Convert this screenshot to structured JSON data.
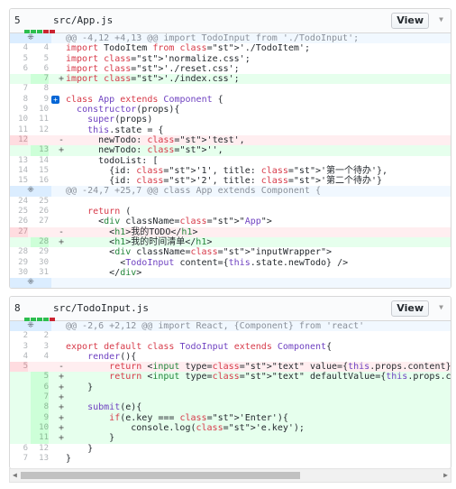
{
  "files": [
    {
      "count": "5",
      "path": "src/App.js",
      "view_label": "View",
      "bars": [
        "#2cbe4e",
        "#2cbe4e",
        "#2cbe4e",
        "#cb2431",
        "#cb2431"
      ],
      "rows": [
        {
          "t": "hunk",
          "o": "",
          "n": "",
          "s": "",
          "c": "@@ -4,12 +4,13 @@ import TodoInput from './TodoInput';"
        },
        {
          "t": "ctx",
          "o": "4",
          "n": "4",
          "s": "",
          "c": "import TodoItem from './TodoItem';"
        },
        {
          "t": "ctx",
          "o": "5",
          "n": "5",
          "s": "",
          "c": "import 'normalize.css';"
        },
        {
          "t": "ctx",
          "o": "6",
          "n": "6",
          "s": "",
          "c": "import './reset.css';"
        },
        {
          "t": "add",
          "o": "",
          "n": "7",
          "s": "+",
          "c": "import './index.css';"
        },
        {
          "t": "ctx",
          "o": "7",
          "n": "8",
          "s": "",
          "c": ""
        },
        {
          "t": "ctx",
          "o": "8",
          "n": "9",
          "s": "",
          "c": "class App extends Component {"
        },
        {
          "t": "ctx",
          "o": "9",
          "n": "10",
          "s": "",
          "c": "  constructor(props){"
        },
        {
          "t": "ctx",
          "o": "10",
          "n": "11",
          "s": "",
          "c": "    super(props)"
        },
        {
          "t": "ctx",
          "o": "11",
          "n": "12",
          "s": "",
          "c": "    this.state = {"
        },
        {
          "t": "del",
          "o": "12",
          "n": "",
          "s": "-",
          "c": "      newTodo: 'test',"
        },
        {
          "t": "add",
          "o": "",
          "n": "13",
          "s": "+",
          "c": "      newTodo: '',"
        },
        {
          "t": "ctx",
          "o": "13",
          "n": "14",
          "s": "",
          "c": "      todoList: ["
        },
        {
          "t": "ctx",
          "o": "14",
          "n": "15",
          "s": "",
          "c": "        {id: '1', title: '第一个待办'},"
        },
        {
          "t": "ctx",
          "o": "15",
          "n": "16",
          "s": "",
          "c": "        {id: '2', title: '第二个待办'}"
        },
        {
          "t": "hunk",
          "o": "",
          "n": "",
          "s": "",
          "c": "@@ -24,7 +25,7 @@ class App extends Component {"
        },
        {
          "t": "ctx",
          "o": "24",
          "n": "25",
          "s": "",
          "c": ""
        },
        {
          "t": "ctx",
          "o": "25",
          "n": "26",
          "s": "",
          "c": "    return ("
        },
        {
          "t": "ctx",
          "o": "26",
          "n": "27",
          "s": "",
          "c": "      <div className=\"App\">"
        },
        {
          "t": "del",
          "o": "27",
          "n": "",
          "s": "-",
          "c": "        <h1>我的TODO</h1>"
        },
        {
          "t": "add",
          "o": "",
          "n": "28",
          "s": "+",
          "c": "        <h1>我的时间清单</h1>"
        },
        {
          "t": "ctx",
          "o": "28",
          "n": "29",
          "s": "",
          "c": "        <div className=\"inputWrapper\">"
        },
        {
          "t": "ctx",
          "o": "29",
          "n": "30",
          "s": "",
          "c": "          <TodoInput content={this.state.newTodo} />"
        },
        {
          "t": "ctx",
          "o": "30",
          "n": "31",
          "s": "",
          "c": "        </div>"
        },
        {
          "t": "hunk",
          "o": "",
          "n": "",
          "s": "",
          "c": ""
        }
      ]
    },
    {
      "count": "8",
      "path": "src/TodoInput.js",
      "view_label": "View",
      "bars": [
        "#2cbe4e",
        "#2cbe4e",
        "#2cbe4e",
        "#2cbe4e",
        "#cb2431"
      ],
      "rows": [
        {
          "t": "hunk",
          "o": "",
          "n": "",
          "s": "",
          "c": "@@ -2,6 +2,12 @@ import React, {Component} from 'react'"
        },
        {
          "t": "ctx",
          "o": "2",
          "n": "2",
          "s": "",
          "c": ""
        },
        {
          "t": "ctx",
          "o": "3",
          "n": "3",
          "s": "",
          "c": "export default class TodoInput extends Component{"
        },
        {
          "t": "ctx",
          "o": "4",
          "n": "4",
          "s": "",
          "c": "    render(){"
        },
        {
          "t": "del",
          "o": "5",
          "n": "",
          "s": "-",
          "c": "        return <input type=\"text\" value={this.props.content}/>"
        },
        {
          "t": "add",
          "o": "",
          "n": "5",
          "s": "+",
          "c": "        return <input type=\"text\" defaultValue={this.props.content}"
        },
        {
          "t": "add",
          "o": "",
          "n": "6",
          "s": "+",
          "c": "    }"
        },
        {
          "t": "add",
          "o": "",
          "n": "7",
          "s": "+",
          "c": ""
        },
        {
          "t": "add",
          "o": "",
          "n": "8",
          "s": "+",
          "c": "    submit(e){"
        },
        {
          "t": "add",
          "o": "",
          "n": "9",
          "s": "+",
          "c": "        if(e.key === 'Enter'){"
        },
        {
          "t": "add",
          "o": "",
          "n": "10",
          "s": "+",
          "c": "            console.log('e.key');"
        },
        {
          "t": "add",
          "o": "",
          "n": "11",
          "s": "+",
          "c": "        }"
        },
        {
          "t": "ctx",
          "o": "6",
          "n": "12",
          "s": "",
          "c": "    }"
        },
        {
          "t": "ctx",
          "o": "7",
          "n": "13",
          "s": "",
          "c": "}"
        }
      ]
    }
  ]
}
